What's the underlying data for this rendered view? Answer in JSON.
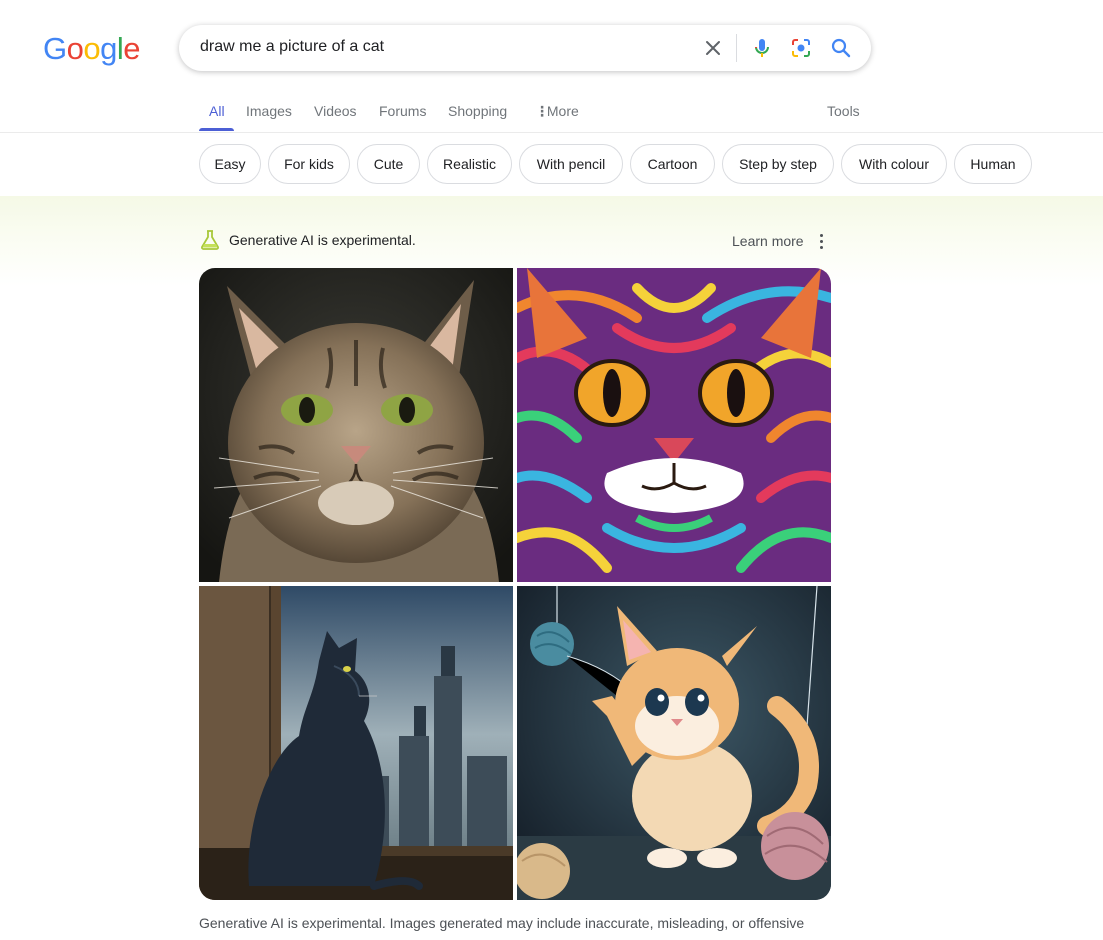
{
  "logo": {
    "letters": [
      {
        "char": "G",
        "color": "#4285F4"
      },
      {
        "char": "o",
        "color": "#EA4335"
      },
      {
        "char": "o",
        "color": "#FBBC05"
      },
      {
        "char": "g",
        "color": "#4285F4"
      },
      {
        "char": "l",
        "color": "#34A853"
      },
      {
        "char": "e",
        "color": "#EA4335"
      }
    ]
  },
  "search": {
    "query": "draw me a picture of a cat",
    "icons": [
      "close-icon",
      "microphone-icon",
      "lens-icon",
      "search-icon"
    ]
  },
  "tabs": {
    "items": [
      {
        "label": "All",
        "active": true
      },
      {
        "label": "Images",
        "active": false
      },
      {
        "label": "Videos",
        "active": false
      },
      {
        "label": "Forums",
        "active": false
      },
      {
        "label": "Shopping",
        "active": false
      },
      {
        "label": "More",
        "active": false
      }
    ],
    "tools_label": "Tools"
  },
  "chips": [
    "Easy",
    "For kids",
    "Cute",
    "Realistic",
    "With pencil",
    "Cartoon",
    "Step by step",
    "With colour",
    "Human"
  ],
  "ai": {
    "title": "Generative AI is experimental.",
    "learn_more": "Learn more",
    "images": [
      {
        "subject": "tabby-cat-photo"
      },
      {
        "subject": "colorful-abstract-cat"
      },
      {
        "subject": "black-cat-window-city"
      },
      {
        "subject": "kitten-yarn-balls"
      }
    ],
    "disclaimer": "Generative AI is experimental. Images generated may include inaccurate, misleading, or offensive"
  },
  "colors": {
    "accent": "#4c5fd5",
    "muted_text": "#70757a",
    "chip_border": "#dadce0",
    "ai_band": "#f5f9e6"
  }
}
